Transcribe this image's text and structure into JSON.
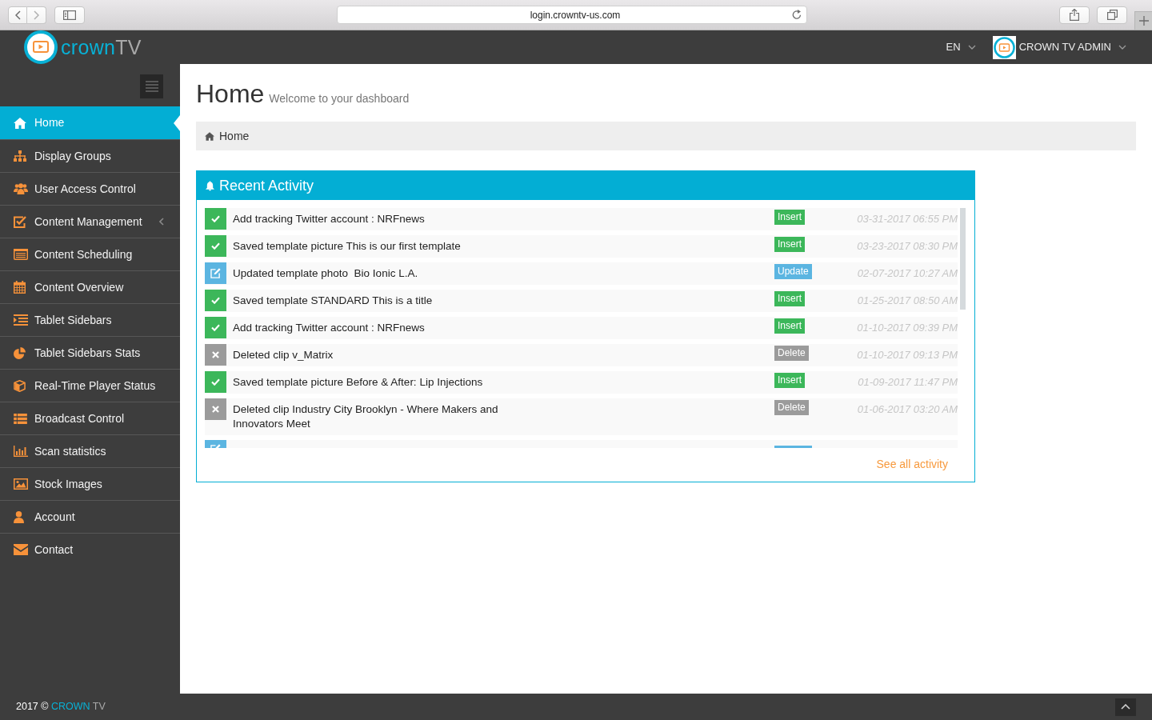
{
  "browser": {
    "url": "login.crowntv-us.com"
  },
  "header": {
    "logo": {
      "first": "crown",
      "second": "TV"
    },
    "language": "EN",
    "user": "CROWN TV ADMIN"
  },
  "sidebar": {
    "items": [
      {
        "label": "Home",
        "kind": "home",
        "selected": true,
        "expandable": false
      },
      {
        "label": "Display Groups",
        "kind": "sitemap",
        "selected": false,
        "expandable": false
      },
      {
        "label": "User Access Control",
        "kind": "users",
        "selected": false,
        "expandable": false
      },
      {
        "label": "Content Management",
        "kind": "checklist",
        "selected": false,
        "expandable": true
      },
      {
        "label": "Content Scheduling",
        "kind": "schedule",
        "selected": false,
        "expandable": false
      },
      {
        "label": "Content Overview",
        "kind": "calendar",
        "selected": false,
        "expandable": false
      },
      {
        "label": "Tablet Sidebars",
        "kind": "indent",
        "selected": false,
        "expandable": false
      },
      {
        "label": "Tablet Sidebars Stats",
        "kind": "pie",
        "selected": false,
        "expandable": false
      },
      {
        "label": "Real-Time Player Status",
        "kind": "cube",
        "selected": false,
        "expandable": false
      },
      {
        "label": "Broadcast Control",
        "kind": "list",
        "selected": false,
        "expandable": false
      },
      {
        "label": "Scan statistics",
        "kind": "bars",
        "selected": false,
        "expandable": false
      },
      {
        "label": "Stock Images",
        "kind": "image",
        "selected": false,
        "expandable": false
      },
      {
        "label": "Account",
        "kind": "user",
        "selected": false,
        "expandable": false
      },
      {
        "label": "Contact",
        "kind": "envelope",
        "selected": false,
        "expandable": false
      }
    ]
  },
  "page": {
    "title": "Home",
    "subtitle": "Welcome to your dashboard",
    "breadcrumb": [
      {
        "label": "Home"
      }
    ]
  },
  "activity": {
    "title": "Recent Activity",
    "rows": [
      {
        "kind": "insert",
        "text": "Add tracking Twitter account : NRFnews",
        "badge": "Insert",
        "time": "03-31-2017 06:55 PM"
      },
      {
        "kind": "insert",
        "text": "Saved template picture This is our first template",
        "badge": "Insert",
        "time": "03-23-2017 08:30 PM"
      },
      {
        "kind": "update",
        "text": "Updated template photo  Bio Ionic L.A.",
        "badge": "Update",
        "time": "02-07-2017 10:27 AM"
      },
      {
        "kind": "insert",
        "text": "Saved template STANDARD This is a title",
        "badge": "Insert",
        "time": "01-25-2017 08:50 AM"
      },
      {
        "kind": "insert",
        "text": "Add tracking Twitter account : NRFnews",
        "badge": "Insert",
        "time": "01-10-2017 09:39 PM"
      },
      {
        "kind": "delete",
        "text": "Deleted clip v_Matrix",
        "badge": "Delete",
        "time": "01-10-2017 09:13 PM"
      },
      {
        "kind": "insert",
        "text": "Saved template picture Before & After: Lip Injections",
        "badge": "Insert",
        "time": "01-09-2017 11:47 PM"
      },
      {
        "kind": "delete",
        "text": "Deleted clip Industry City Brooklyn - Where Makers and Innovators Meet",
        "badge": "Delete",
        "time": "01-06-2017 03:20 AM"
      },
      {
        "kind": "update"
      }
    ],
    "link": "See all activity"
  },
  "footer": {
    "year": "2017 ©",
    "brand_first": "CROWN",
    "brand_second": "TV"
  }
}
